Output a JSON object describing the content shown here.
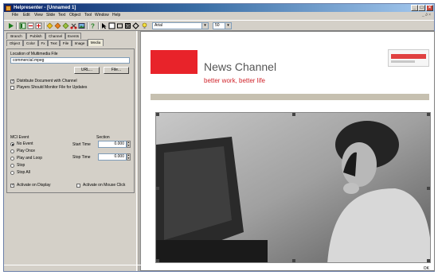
{
  "window": {
    "title": "Helpresenter - [Unnamed 1]",
    "controls": [
      "_",
      "□",
      "×"
    ]
  },
  "menu": {
    "items": [
      "File",
      "Edit",
      "View",
      "Slide",
      "Text",
      "Object",
      "Tool",
      "Window",
      "Help"
    ],
    "right": "_ ∂ ×"
  },
  "toolbar": {
    "font_name": "Arial",
    "font_size": "50"
  },
  "panel": {
    "tabs_row1": [
      "Branch",
      "Publish",
      "Channel",
      "Events"
    ],
    "tabs_row2": [
      "Object",
      "Color",
      "Fx",
      "Text",
      "File",
      "Image",
      "Media"
    ],
    "selected_tab": "Media",
    "location_label": "Location of Multimedia File",
    "file_value": "commercial.mpeg",
    "url_button": "URL...",
    "file_button": "File...",
    "distribute_label": "Distribute Document with Channel",
    "distribute_checked": true,
    "monitor_label": "Players Should Monitor File for Updates",
    "monitor_checked": false,
    "mci_event_label": "MCI Event",
    "section_label": "Section",
    "events": [
      "No Event",
      "Play Once",
      "Play and Loop",
      "Stop",
      "Stop All"
    ],
    "selected_event": "No Event",
    "start_time_label": "Start Time",
    "start_time_value": "0.000",
    "stop_time_label": "Stop Time",
    "stop_time_value": "0.000",
    "activate_display_label": "Activate on Display",
    "activate_display_checked": true,
    "activate_click_label": "Activate on Mouse Click",
    "activate_click_checked": false
  },
  "stage": {
    "brand": "News Channel",
    "tagline": "better work, better life",
    "colors": {
      "accent": "#e8232a",
      "tagline": "#d0232a",
      "rule": "#c6c0b0"
    }
  },
  "status": {
    "right": "OK"
  }
}
